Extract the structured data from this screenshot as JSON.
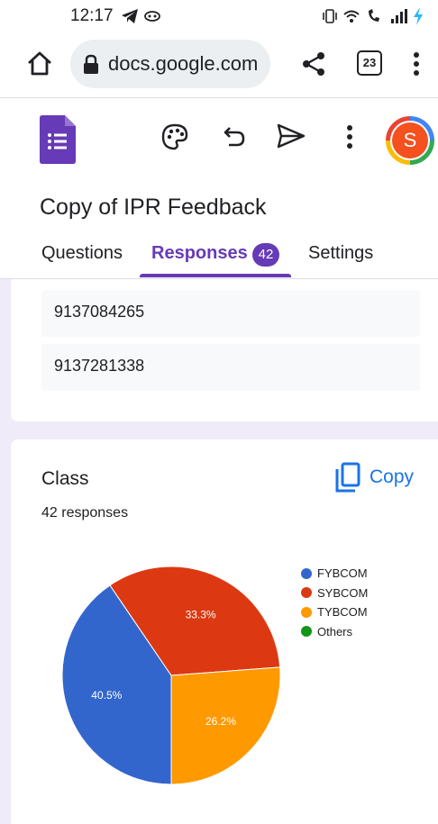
{
  "status_bar": {
    "time": "12:17"
  },
  "browser": {
    "url": "docs.google.com",
    "tab_count": "23"
  },
  "app": {
    "avatar_letter": "S"
  },
  "form": {
    "title": "Copy of IPR Feedback"
  },
  "tabs": [
    {
      "label": "Questions"
    },
    {
      "label": "Responses",
      "badge": "42",
      "active": true
    },
    {
      "label": "Settings"
    }
  ],
  "previous_question": {
    "answers": [
      "9137084265",
      "9137281338"
    ]
  },
  "question": {
    "title": "Class",
    "responses": "42 responses",
    "copy_label": "Copy"
  },
  "chart_data": {
    "type": "pie",
    "slices": [
      {
        "name": "FYBCOM",
        "value": 40.5,
        "label": "40.5%",
        "color": "#3366cc"
      },
      {
        "name": "SYBCOM",
        "value": 33.3,
        "label": "33.3%",
        "color": "#dc3912"
      },
      {
        "name": "TYBCOM",
        "value": 26.2,
        "label": "26.2%",
        "color": "#ff9900"
      },
      {
        "name": "Others",
        "value": 0,
        "label": "",
        "color": "#109618"
      }
    ],
    "legend_position": "right"
  }
}
